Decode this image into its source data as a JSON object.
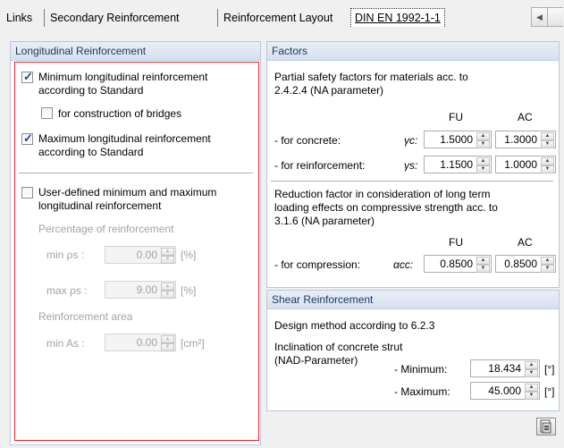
{
  "tabs": [
    {
      "label": "Links"
    },
    {
      "label": "Secondary Reinforcement"
    },
    {
      "label": "Reinforcement Layout"
    },
    {
      "label": "DIN EN 1992-1-1"
    }
  ],
  "longitudinal": {
    "title": "Longitudinal Reinforcement",
    "min_check": {
      "line1": "Minimum longitudinal reinforcement",
      "line2": "according to Standard",
      "checked": true
    },
    "bridges_check": {
      "label": "for construction of bridges",
      "checked": false
    },
    "max_check": {
      "line1": "Maximum longitudinal reinforcement",
      "line2": "according to Standard",
      "checked": true
    },
    "user_check": {
      "line1": "User-defined minimum and maximum",
      "line2": "longitudinal reinforcement",
      "checked": false
    },
    "percentage_label": "Percentage of reinforcement",
    "min_rho": {
      "label": "min ρs :",
      "value": "0.00",
      "unit": "[%]"
    },
    "max_rho": {
      "label": "max ρs :",
      "value": "9.00",
      "unit": "[%]"
    },
    "area_label": "Reinforcement area",
    "min_as": {
      "label": "min As :",
      "value": "0.00",
      "unit": "[cm²]"
    }
  },
  "factors": {
    "title": "Factors",
    "desc_line1": "Partial safety factors for materials acc. to",
    "desc_line2": "2.4.2.4 (NA parameter)",
    "col_fu": "FU",
    "col_ac": "AC",
    "concrete": {
      "label": "- for concrete:",
      "symbol": "γc:",
      "fu": "1.5000",
      "ac": "1.3000"
    },
    "reinforcement": {
      "label": "- for reinforcement:",
      "symbol": "γs:",
      "fu": "1.1500",
      "ac": "1.0000"
    },
    "reduction_line1": "Reduction factor in consideration of long term",
    "reduction_line2": "loading effects on compressive strength acc. to",
    "reduction_line3": "3.1.6 (NA parameter)",
    "col_fu2": "FU",
    "col_ac2": "AC",
    "compression": {
      "label": "- for compression:",
      "symbol": "αcc:",
      "fu": "0.8500",
      "ac": "0.8500"
    }
  },
  "shear": {
    "title": "Shear Reinforcement",
    "method": "Design method according to 6.2.3",
    "incl_line1": "Inclination of concrete strut",
    "incl_line2": "(NAD-Parameter)",
    "minimum": {
      "label": "- Minimum:",
      "value": "18.434",
      "unit": "[°]"
    },
    "maximum": {
      "label": "- Maximum:",
      "value": "45.000",
      "unit": "[°]"
    }
  },
  "colors": {
    "highlight_border": "#e0262c",
    "panel_header": "#d6e0ee"
  }
}
